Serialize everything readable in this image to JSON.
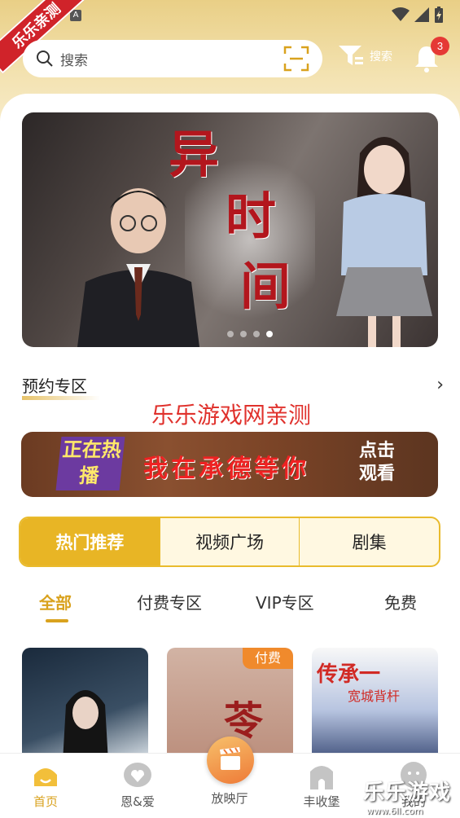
{
  "watermark": {
    "ribbon": "乐乐亲测",
    "center": "乐乐游戏网亲测",
    "corner_title": "乐乐游戏",
    "corner_url": "www.6ll.com"
  },
  "header": {
    "search_placeholder": "搜索",
    "filter_label": "搜索",
    "notification_count": "3"
  },
  "banner": {
    "title_chars": [
      "异",
      "时",
      "间"
    ],
    "dots": 4,
    "active_dot": 3
  },
  "reservation": {
    "title": "预约专区",
    "more": "›"
  },
  "promo": {
    "onair": "正在热播",
    "slogan": "我在承德等你",
    "cta": "点击观看"
  },
  "tabs": [
    {
      "label": "热门推荐",
      "active": true
    },
    {
      "label": "视频广场",
      "active": false
    },
    {
      "label": "剧集",
      "active": false
    }
  ],
  "subtabs": [
    {
      "label": "全部",
      "active": true
    },
    {
      "label": "付费专区",
      "active": false
    },
    {
      "label": "VIP专区",
      "active": false
    },
    {
      "label": "免费",
      "active": false
    }
  ],
  "cards": [
    {
      "badge": ""
    },
    {
      "badge": "付费",
      "text": "苓"
    },
    {
      "badge": "",
      "text": "传承一",
      "text2": "宽城背杆"
    }
  ],
  "nav": [
    {
      "label": "首页",
      "icon": "home-icon",
      "active": true
    },
    {
      "label": "恩&爱",
      "icon": "heart-icon",
      "active": false
    },
    {
      "label": "放映厅",
      "icon": "clapperboard-icon",
      "active": false
    },
    {
      "label": "丰收堡",
      "icon": "castle-icon",
      "active": false
    },
    {
      "label": "我的",
      "icon": "profile-icon",
      "active": false
    }
  ],
  "colors": {
    "accent": "#e8b525",
    "gold_bg": "#e9cf86",
    "badge_red": "#e53935",
    "paid_orange": "#f08a2c"
  }
}
